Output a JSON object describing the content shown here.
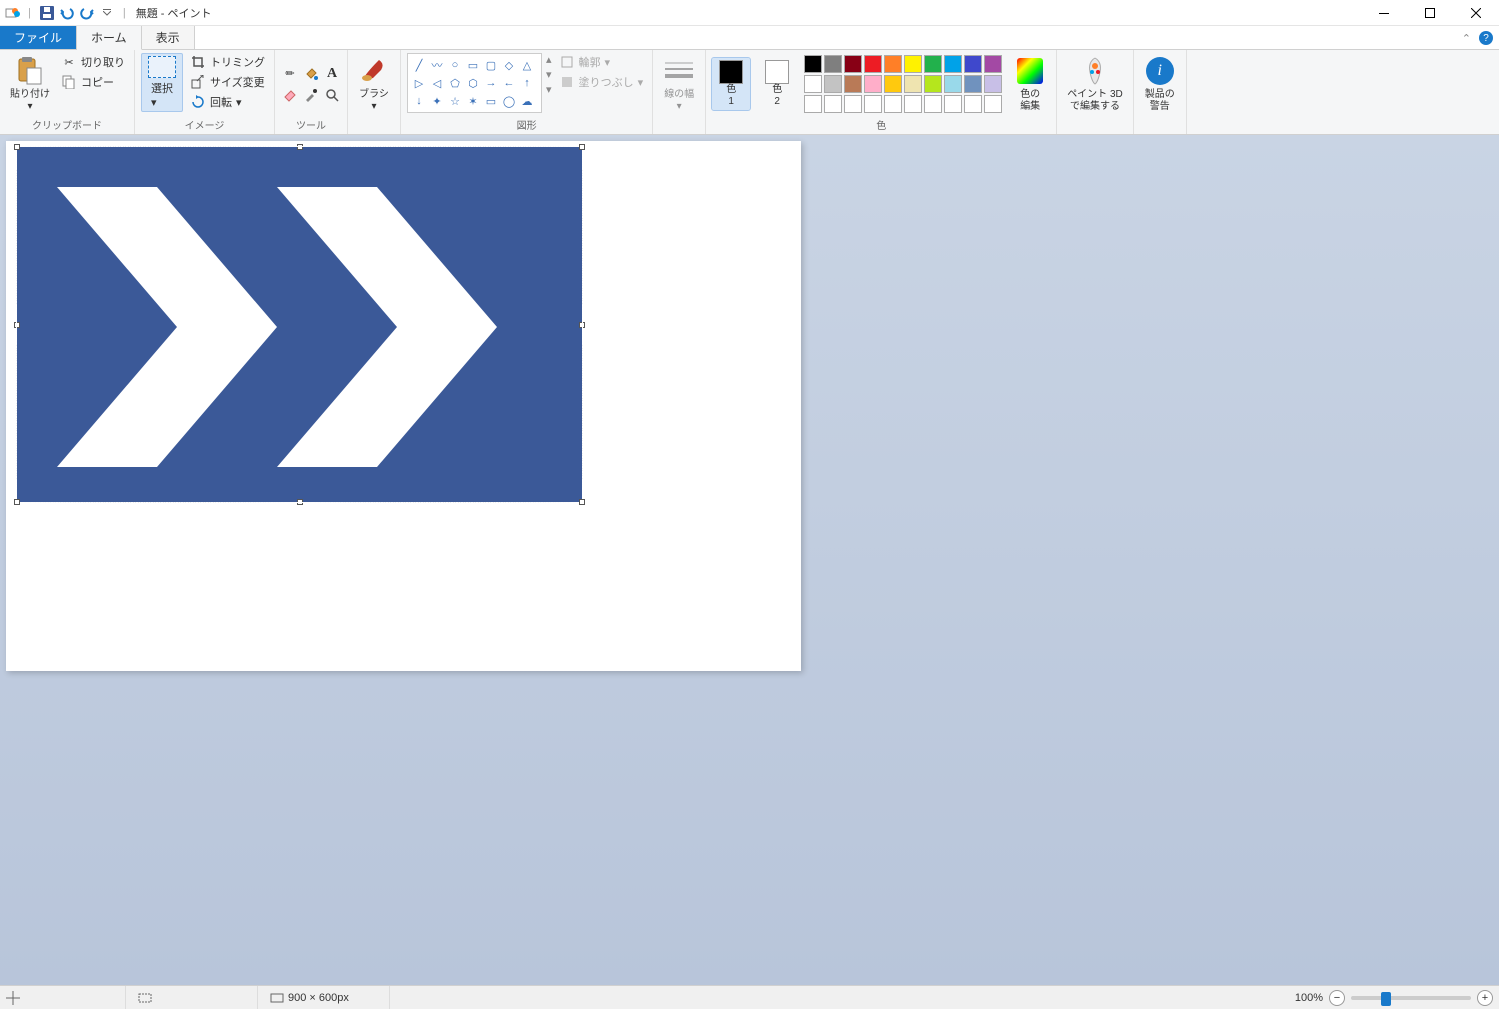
{
  "title": "無題 - ペイント",
  "tabs": {
    "file": "ファイル",
    "home": "ホーム",
    "view": "表示"
  },
  "ribbon": {
    "clipboard": {
      "label": "クリップボード",
      "paste": "貼り付け",
      "cut": "切り取り",
      "copy": "コピー"
    },
    "image": {
      "label": "イメージ",
      "select": "選択",
      "crop": "トリミング",
      "resize": "サイズ変更",
      "rotate": "回転"
    },
    "tools": {
      "label": "ツール"
    },
    "brush": {
      "label": "ブラシ"
    },
    "shapes": {
      "label": "図形",
      "outline": "輪郭",
      "fill": "塗りつぶし"
    },
    "linewidth": {
      "label": "線の幅"
    },
    "colors": {
      "label": "色",
      "c1": "色\n1",
      "c2": "色\n2",
      "edit": "色の\n編集",
      "row1": [
        "#000000",
        "#7f7f7f",
        "#880015",
        "#ed1c24",
        "#ff7f27",
        "#fff200",
        "#22b14c",
        "#00a2e8",
        "#3f48cc",
        "#a349a4"
      ],
      "row2": [
        "#ffffff",
        "#c3c3c3",
        "#b97a57",
        "#ffaec9",
        "#ffc90e",
        "#efe4b0",
        "#b5e61d",
        "#99d9ea",
        "#7092be",
        "#c8bfe7"
      ]
    },
    "paint3d": {
      "label": "ペイント 3D\nで編集する"
    },
    "alerts": {
      "label": "製品の\n警告"
    }
  },
  "status": {
    "pos": "",
    "sel": "",
    "size": "900 × 600px",
    "zoom": "100%"
  }
}
